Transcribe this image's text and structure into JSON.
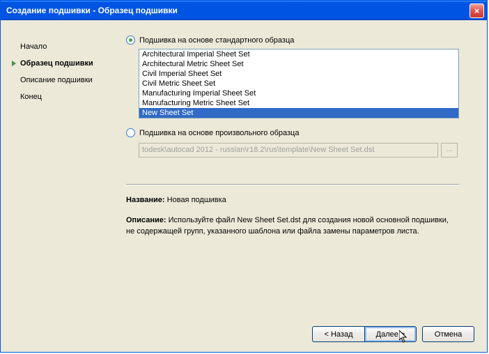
{
  "window": {
    "title": "Создание подшивки - Образец подшивки",
    "close": "×"
  },
  "sidebar": {
    "items": [
      {
        "label": "Начало"
      },
      {
        "label": "Образец подшивки"
      },
      {
        "label": "Описание подшивки"
      },
      {
        "label": "Конец"
      }
    ]
  },
  "main": {
    "radio1_label": "Подшивка на основе стандартного образца",
    "radio2_label": "Подшивка на основе произвольного образца",
    "list_items": [
      "Architectural Imperial Sheet Set",
      "Architectural Metric Sheet Set",
      "Civil Imperial Sheet Set",
      "Civil Metric Sheet Set",
      "Manufacturing Imperial Sheet Set",
      "Manufacturing Metric Sheet Set",
      "New Sheet Set"
    ],
    "selected_index": 6,
    "path_value": "todesk\\autocad 2012 - russian\\r18.2\\rus\\template\\New Sheet Set.dst",
    "browse": "...",
    "name_label": "Название:",
    "name_value": "Новая подшивка",
    "desc_label": "Описание:",
    "desc_value": "Используйте файл New Sheet Set.dst для создания новой основной подшивки, не содержащей групп, указанного шаблона или файла замены параметров листа."
  },
  "buttons": {
    "back": "< Назад",
    "next": "Далее >",
    "cancel": "Отмена"
  }
}
